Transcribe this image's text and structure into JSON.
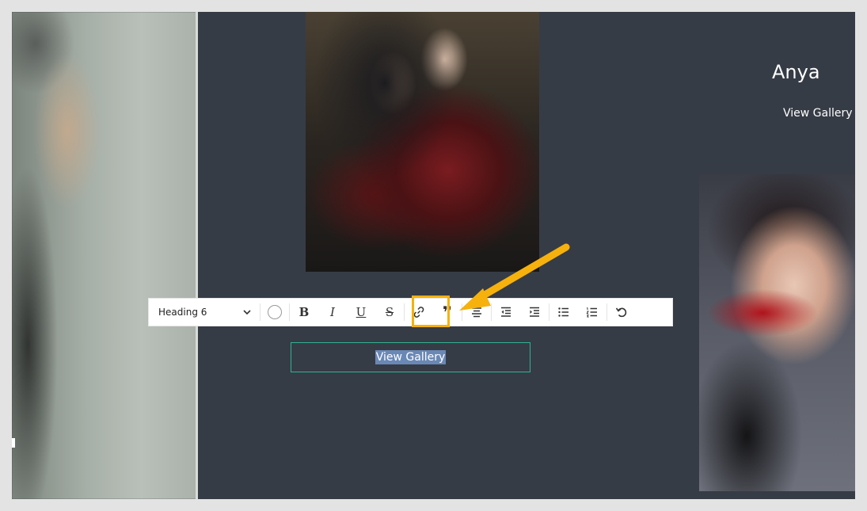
{
  "gallery": {
    "model_name": "Anya",
    "view_gallery_link": "View Gallery"
  },
  "toolbar": {
    "format_selected": "Heading 6",
    "format_options": [
      "Heading 6"
    ],
    "bold_glyph": "B",
    "italic_glyph": "I",
    "underline_glyph": "U",
    "strike_glyph": "S",
    "quote_glyph": "❞"
  },
  "editor": {
    "selected_text": "View Gallery"
  },
  "colors": {
    "canvas_bg": "#363c46",
    "accent_highlight": "#f6b10d",
    "field_border": "#2fb38f",
    "selection_bg": "#6a88b5"
  },
  "icons": [
    "chevron-down-icon",
    "color-circle-icon",
    "bold-icon",
    "italic-icon",
    "underline-icon",
    "strikethrough-icon",
    "link-icon",
    "quote-icon",
    "align-center-icon",
    "outdent-icon",
    "indent-icon",
    "bullet-list-icon",
    "numbered-list-icon",
    "undo-icon",
    "arrow-annotation-icon"
  ]
}
